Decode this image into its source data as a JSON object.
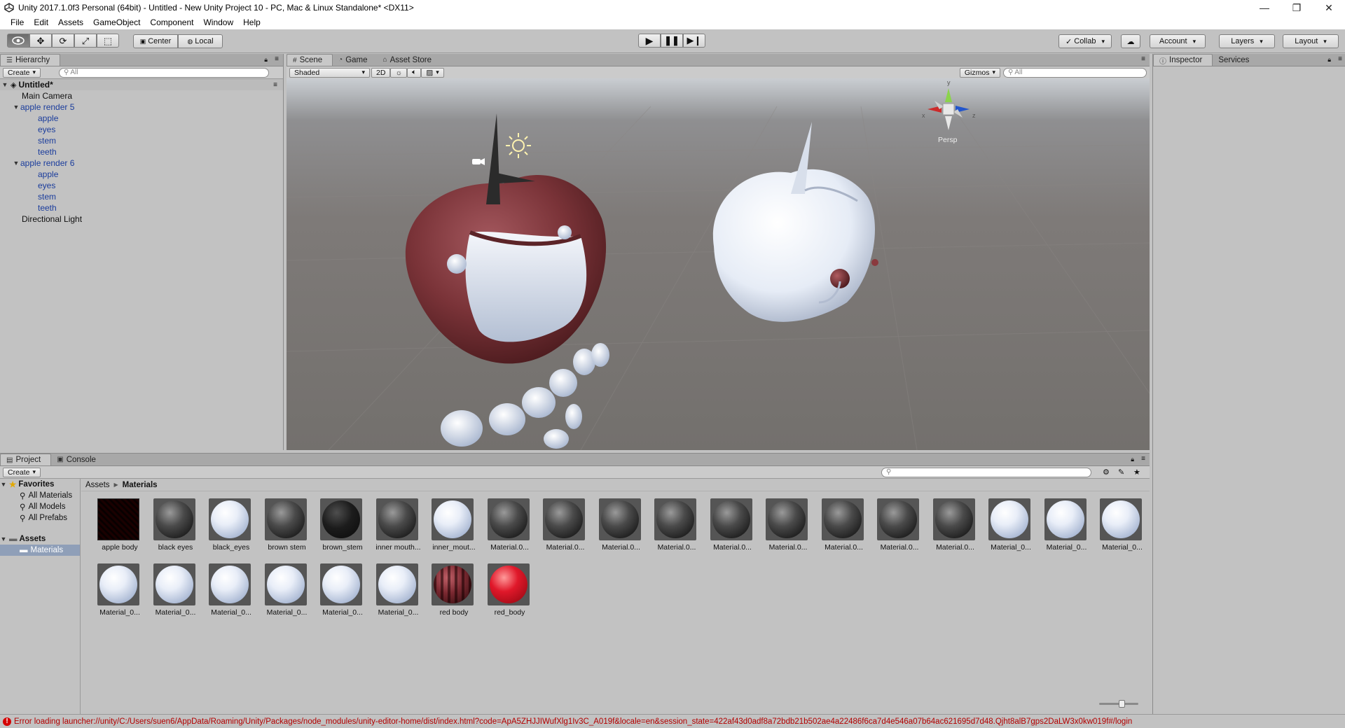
{
  "window": {
    "title": "Unity 2017.1.0f3 Personal (64bit) - Untitled - New Unity Project 10 - PC, Mac & Linux Standalone* <DX11>",
    "minimize": "—",
    "restore": "❐",
    "close": "✕"
  },
  "menu": [
    "File",
    "Edit",
    "Assets",
    "GameObject",
    "Component",
    "Window",
    "Help"
  ],
  "toolbar": {
    "tools": [
      "view",
      "move",
      "rotate",
      "scale",
      "rect"
    ],
    "active_tool": "view",
    "pivot": "Center",
    "space": "Local",
    "collab": "Collab",
    "account": "Account",
    "layers": "Layers",
    "layout": "Layout"
  },
  "hierarchy": {
    "tab": "Hierarchy",
    "create": "Create",
    "search_placeholder": "All",
    "scene_name": "Untitled*",
    "items": [
      {
        "label": "Main Camera",
        "depth": 1,
        "blue": false,
        "arrow": ""
      },
      {
        "label": "apple render 5",
        "depth": 1,
        "blue": true,
        "arrow": "▼"
      },
      {
        "label": "apple",
        "depth": 2,
        "blue": true,
        "arrow": ""
      },
      {
        "label": "eyes",
        "depth": 2,
        "blue": true,
        "arrow": ""
      },
      {
        "label": "stem",
        "depth": 2,
        "blue": true,
        "arrow": ""
      },
      {
        "label": "teeth",
        "depth": 2,
        "blue": true,
        "arrow": ""
      },
      {
        "label": "apple render 6",
        "depth": 1,
        "blue": true,
        "arrow": "▼"
      },
      {
        "label": "apple",
        "depth": 2,
        "blue": true,
        "arrow": ""
      },
      {
        "label": "eyes",
        "depth": 2,
        "blue": true,
        "arrow": ""
      },
      {
        "label": "stem",
        "depth": 2,
        "blue": true,
        "arrow": ""
      },
      {
        "label": "teeth",
        "depth": 2,
        "blue": true,
        "arrow": ""
      },
      {
        "label": "Directional Light",
        "depth": 1,
        "blue": false,
        "arrow": ""
      }
    ]
  },
  "scene": {
    "tabs": [
      "Scene",
      "Game",
      "Asset Store"
    ],
    "active_tab": "Scene",
    "shading": "Shaded",
    "mode_2d": "2D",
    "gizmos": "Gizmos",
    "search_placeholder": "All",
    "persp": "Persp",
    "axis_y": "y",
    "axis_x": "x",
    "axis_z": "z"
  },
  "inspector": {
    "tabs": [
      "Inspector",
      "Services"
    ]
  },
  "project": {
    "tabs": [
      "Project",
      "Console"
    ],
    "create": "Create",
    "favorites": {
      "header": "Favorites",
      "items": [
        "All Materials",
        "All Models",
        "All Prefabs"
      ]
    },
    "assets": {
      "header": "Assets",
      "items": [
        "Materials"
      ]
    },
    "breadcrumb": [
      "Assets",
      "Materials"
    ],
    "materials": [
      {
        "name": "apple body",
        "kind": "texture"
      },
      {
        "name": "black eyes",
        "kind": "dark"
      },
      {
        "name": "black_eyes",
        "kind": "white"
      },
      {
        "name": "brown stem",
        "kind": "dark"
      },
      {
        "name": "brown_stem",
        "kind": "black"
      },
      {
        "name": "inner mouth...",
        "kind": "dark"
      },
      {
        "name": "inner_mout...",
        "kind": "white"
      },
      {
        "name": "Material.0...",
        "kind": "dark"
      },
      {
        "name": "Material.0...",
        "kind": "dark"
      },
      {
        "name": "Material.0...",
        "kind": "dark"
      },
      {
        "name": "Material.0...",
        "kind": "dark"
      },
      {
        "name": "Material.0...",
        "kind": "dark"
      },
      {
        "name": "Material.0...",
        "kind": "dark"
      },
      {
        "name": "Material.0...",
        "kind": "dark"
      },
      {
        "name": "Material.0...",
        "kind": "dark"
      },
      {
        "name": "Material.0...",
        "kind": "dark"
      },
      {
        "name": "Material_0...",
        "kind": "white"
      },
      {
        "name": "Material_0...",
        "kind": "white"
      },
      {
        "name": "Material_0...",
        "kind": "white"
      },
      {
        "name": "Material_0...",
        "kind": "white"
      },
      {
        "name": "Material_0...",
        "kind": "white"
      },
      {
        "name": "Material_0...",
        "kind": "white"
      },
      {
        "name": "Material_0...",
        "kind": "white"
      },
      {
        "name": "Material_0...",
        "kind": "white"
      },
      {
        "name": "Material_0...",
        "kind": "white"
      },
      {
        "name": "red body",
        "kind": "redtexture"
      },
      {
        "name": "red_body",
        "kind": "red"
      }
    ]
  },
  "status": {
    "error": "Error loading launcher://unity/C:/Users/suen6/AppData/Roaming/Unity/Packages/node_modules/unity-editor-home/dist/index.html?code=ApA5ZHJJIWufXlg1Iv3C_A019f&locale=en&session_state=422af43d0adf8a72bdb21b502ae4a22486f6ca7d4e546a07b64ac621695d7d48.Qjht8alB7gps2DaLW3x0kw019f#/login"
  },
  "colors": {
    "accent_blue": "#1a3c9c",
    "error_red": "#b30000",
    "selection": "#8f9fb8"
  }
}
